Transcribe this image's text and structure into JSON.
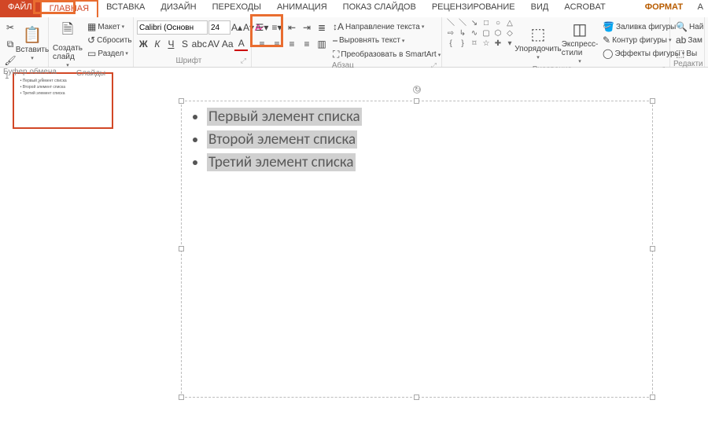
{
  "tabs": {
    "file": "ФАЙЛ",
    "home": "ГЛАВНАЯ",
    "insert": "ВСТАВКА",
    "design": "ДИЗАЙН",
    "transitions": "ПЕРЕХОДЫ",
    "animations": "АНИМАЦИЯ",
    "slideshow": "ПОКАЗ СЛАЙДОВ",
    "review": "РЕЦЕНЗИРОВАНИЕ",
    "view": "ВИД",
    "acrobat": "ACROBAT",
    "format": "ФОРМАТ",
    "right_a": "А"
  },
  "clipboard": {
    "paste": "Вставить",
    "label": "Буфер обмена"
  },
  "slides": {
    "new_slide": "Создать\nслайд",
    "layout": "Макет",
    "reset": "Сбросить",
    "section": "Раздел",
    "label": "Слайды"
  },
  "font": {
    "name": "Calibri (Основн",
    "size": "24",
    "label": "Шрифт"
  },
  "paragraph": {
    "text_direction": "Направление текста",
    "align_text": "Выровнять текст",
    "convert_smartart": "Преобразовать в SmartArt",
    "label": "Абзац"
  },
  "drawing": {
    "arrange": "Упорядочить",
    "quick_styles": "Экспресс-\nстили",
    "shape_fill": "Заливка фигуры",
    "shape_outline": "Контур фигуры",
    "shape_effects": "Эффекты фигуры",
    "label": "Рисование"
  },
  "editing": {
    "find": "Най",
    "replace": "Зам",
    "select": "Вы",
    "label": "Редакти"
  },
  "thumb_number": "1",
  "slide_content": {
    "items": [
      "Первый элемент списка",
      "Второй элемент списка",
      "Третий элемент списка"
    ]
  }
}
